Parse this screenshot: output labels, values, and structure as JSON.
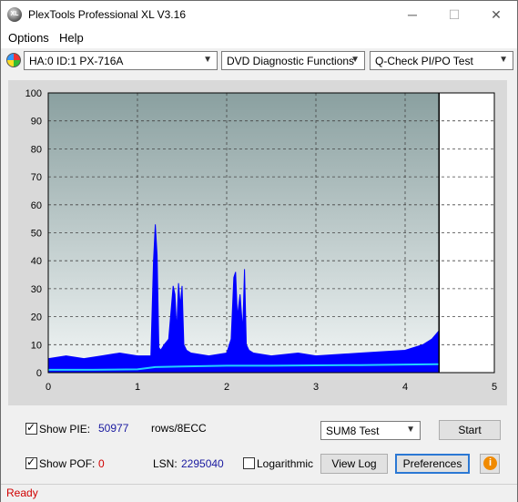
{
  "window": {
    "title": "PlexTools Professional XL V3.16",
    "app_icon_text": "XL"
  },
  "titlebar_buttons": {
    "minimize": "─",
    "maximize": "☐",
    "close": "✕"
  },
  "menu": [
    {
      "label": "Options"
    },
    {
      "label": "Help"
    }
  ],
  "toolbar": {
    "drive": "HA:0 ID:1  PX-716A",
    "function": "DVD Diagnostic Functions",
    "test": "Q-Check PI/PO Test"
  },
  "chart_data": {
    "type": "area",
    "x_ticks": [
      "0",
      "1",
      "2",
      "3",
      "4",
      "5"
    ],
    "y_ticks": [
      "0",
      "10",
      "20",
      "30",
      "40",
      "50",
      "60",
      "70",
      "80",
      "90",
      "100"
    ],
    "xlim": [
      0,
      5
    ],
    "ylim": [
      0,
      100
    ],
    "end_marker_x": 4.38,
    "grid": true,
    "series": [
      {
        "color": "#0000ff",
        "x": [
          0,
          0.2,
          0.4,
          0.6,
          0.8,
          1.0,
          1.15,
          1.18,
          1.2,
          1.22,
          1.24,
          1.26,
          1.3,
          1.35,
          1.4,
          1.42,
          1.44,
          1.46,
          1.48,
          1.5,
          1.52,
          1.55,
          1.6,
          1.8,
          2.0,
          2.05,
          2.08,
          2.1,
          2.12,
          2.15,
          2.18,
          2.2,
          2.22,
          2.25,
          2.3,
          2.5,
          2.8,
          3.0,
          3.5,
          4.0,
          4.2,
          4.3,
          4.38
        ],
        "values": [
          5,
          6,
          5,
          6,
          7,
          6,
          6,
          40,
          53,
          42,
          9,
          8,
          10,
          12,
          31,
          28,
          15,
          32,
          24,
          31,
          10,
          8,
          7,
          6,
          7,
          12,
          34,
          36,
          20,
          28,
          15,
          37,
          10,
          8,
          7,
          6,
          7,
          6,
          7,
          8,
          10,
          12,
          15
        ]
      },
      {
        "color": "#20d0ff",
        "x": [
          0,
          0.5,
          1.0,
          1.2,
          1.5,
          2.0,
          2.5,
          3.0,
          3.5,
          4.0,
          4.38
        ],
        "values": [
          1,
          1,
          1.2,
          2,
          2.2,
          2.5,
          2.5,
          2.6,
          2.7,
          2.9,
          3
        ]
      }
    ]
  },
  "stats": {
    "show_pie_label": "Show PIE:",
    "pie_value": "50977",
    "pie_unit": "rows/8ECC",
    "show_pof_label": "Show POF:",
    "pof_value": "0",
    "lsn_label": "LSN:",
    "lsn_value": "2295040",
    "log_label": "Logarithmic",
    "test_select": "SUM8 Test"
  },
  "buttons": {
    "start": "Start",
    "view_log": "View Log",
    "preferences": "Preferences",
    "info": "i"
  },
  "status": {
    "text": "Ready"
  }
}
